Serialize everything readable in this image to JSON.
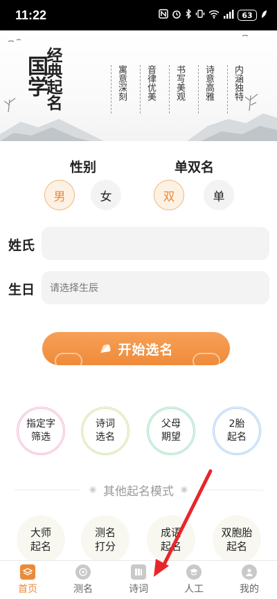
{
  "status_bar": {
    "time": "11:22",
    "battery": "63"
  },
  "banner": {
    "title_main": "国学",
    "title_sub": "经典起名",
    "phrases": [
      "寓意深刻",
      "音律优美",
      "书写美观",
      "诗意高雅",
      "内涵独特"
    ]
  },
  "gender": {
    "label": "性别",
    "options": [
      "男",
      "女"
    ],
    "selected": "男"
  },
  "name_type": {
    "label": "单双名",
    "options": [
      "双",
      "单"
    ],
    "selected": "双"
  },
  "surname": {
    "label": "姓氏",
    "value": "",
    "placeholder": ""
  },
  "birthday": {
    "label": "生日",
    "value": "",
    "placeholder": "请选择生辰"
  },
  "start_button": "开始选名",
  "modes": [
    {
      "label": "指定字\n筛选",
      "color": "#f2b6d6"
    },
    {
      "label": "诗词\n选名",
      "color": "#cfe4a3"
    },
    {
      "label": "父母\n期望",
      "color": "#9fdfbf"
    },
    {
      "label": "2胎\n起名",
      "color": "#a9cdf0"
    }
  ],
  "other_modes": {
    "title": "其他起名模式",
    "items": [
      "大师\n起名",
      "测名\n打分",
      "成语\n起名",
      "双胞胎\n起名"
    ]
  },
  "nav": {
    "items": [
      {
        "label": "首页",
        "icon": "home-icon",
        "active": true
      },
      {
        "label": "测名",
        "icon": "test-name-icon",
        "active": false
      },
      {
        "label": "诗词",
        "icon": "poetry-icon",
        "active": false
      },
      {
        "label": "人工",
        "icon": "graduation-cap-icon",
        "active": false
      },
      {
        "label": "我的",
        "icon": "profile-icon",
        "active": false
      }
    ]
  },
  "colors": {
    "accent": "#ea8b3a",
    "annotation_arrow": "#e8262a"
  }
}
